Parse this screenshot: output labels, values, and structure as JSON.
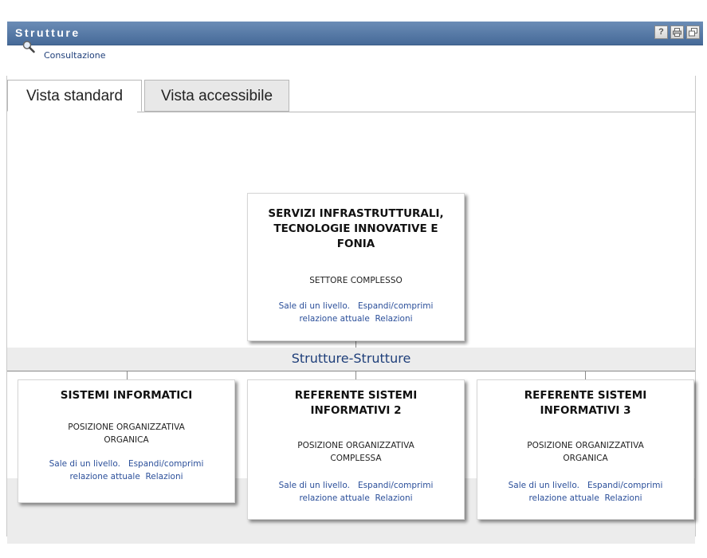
{
  "portlet": {
    "title": "Strutture",
    "buttons": {
      "help": "?",
      "print": "🖶",
      "maximize": "🗗"
    }
  },
  "toolbar": {
    "consult_label": "Consultazione"
  },
  "tabs": [
    {
      "label": "Vista standard",
      "active": true
    },
    {
      "label": "Vista accessibile",
      "active": false
    }
  ],
  "relation_label": "Strutture-Strutture",
  "parent": {
    "title_lines": [
      "SERVIZI INFRASTRUTTURALI,",
      "TECNOLOGIE INNOVATIVE E",
      "FONIA"
    ],
    "type": "SETTORE COMPLESSO",
    "link_up": "Sale di un livello.",
    "link_expand": "Espandi/comprimi",
    "link_expand2": "relazione attuale",
    "link_rel": "Relazioni"
  },
  "children": [
    {
      "title_lines": [
        "SISTEMI INFORMATICI"
      ],
      "type_lines": [
        "POSIZIONE ORGANIZZATIVA",
        "ORGANICA"
      ],
      "link_up": "Sale di un livello.",
      "link_expand": "Espandi/comprimi",
      "link_expand2": "relazione attuale",
      "link_rel": "Relazioni"
    },
    {
      "title_lines": [
        "REFERENTE SISTEMI",
        "INFORMATIVI 2"
      ],
      "type_lines": [
        "POSIZIONE ORGANIZZATIVA",
        "COMPLESSA"
      ],
      "link_up": "Sale di un livello.",
      "link_expand": "Espandi/comprimi",
      "link_expand2": "relazione attuale",
      "link_rel": "Relazioni"
    },
    {
      "title_lines": [
        "REFERENTE SISTEMI",
        "INFORMATIVI 3"
      ],
      "type_lines": [
        "POSIZIONE ORGANIZZATIVA",
        "ORGANICA"
      ],
      "link_up": "Sale di un livello.",
      "link_expand": "Espandi/comprimi",
      "link_expand2": "relazione attuale",
      "link_rel": "Relazioni"
    }
  ],
  "colors": {
    "titlebar": "#4f73a3",
    "link": "#2b4f9a",
    "band": "#ececec"
  }
}
